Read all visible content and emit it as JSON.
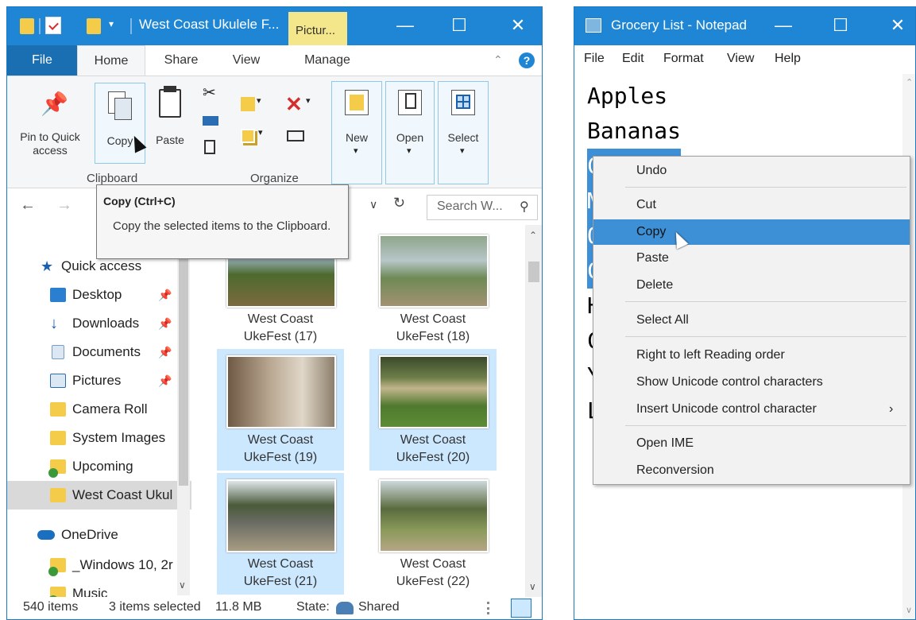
{
  "explorer": {
    "title": "West Coast Ukulele F...",
    "context_tab": "Pictur...",
    "tabs": [
      "File",
      "Home",
      "Share",
      "View",
      "Manage"
    ],
    "ribbon": {
      "pin": "Pin to Quick access",
      "copy": "Copy",
      "paste": "Paste",
      "new": "New",
      "open": "Open",
      "select": "Select",
      "group_clipboard": "Clipboard",
      "group_organize": "Organize"
    },
    "tooltip": {
      "title": "Copy (Ctrl+C)",
      "body": "Copy the selected items to the Clipboard."
    },
    "search_placeholder": "Search W...",
    "nav_items": [
      {
        "label": "Quick access",
        "icon": "star-icon"
      },
      {
        "label": "Desktop",
        "icon": "desktop-icon",
        "pinned": true
      },
      {
        "label": "Downloads",
        "icon": "download-icon",
        "pinned": true
      },
      {
        "label": "Documents",
        "icon": "document-icon",
        "pinned": true
      },
      {
        "label": "Pictures",
        "icon": "pictures-icon",
        "pinned": true
      },
      {
        "label": "Camera Roll",
        "icon": "folder-icon"
      },
      {
        "label": "System Images",
        "icon": "folder-icon"
      },
      {
        "label": "Upcoming",
        "icon": "folder-sync-icon"
      },
      {
        "label": "West Coast Ukul",
        "icon": "folder-icon",
        "selected": true
      },
      {
        "label": "OneDrive",
        "icon": "cloud-icon"
      },
      {
        "label": "_Windows 10, 2r",
        "icon": "folder-sync-icon"
      },
      {
        "label": "Music",
        "icon": "folder-sync-icon"
      }
    ],
    "tiles": [
      {
        "line1": "West Coast",
        "line2": "UkeFest (17)",
        "selected": false
      },
      {
        "line1": "West Coast",
        "line2": "UkeFest (18)",
        "selected": false
      },
      {
        "line1": "West Coast",
        "line2": "UkeFest (19)",
        "selected": true
      },
      {
        "line1": "West Coast",
        "line2": "UkeFest (20)",
        "selected": true
      },
      {
        "line1": "West Coast",
        "line2": "UkeFest (21)",
        "selected": true
      },
      {
        "line1": "West Coast",
        "line2": "UkeFest (22)",
        "selected": false
      }
    ],
    "status": {
      "items": "540 items",
      "selected": "3 items selected",
      "size": "11.8 MB",
      "state_label": "State:",
      "state_value": "Shared"
    }
  },
  "notepad": {
    "title": "Grocery List - Notepad",
    "menu": [
      "File",
      "Edit",
      "Format",
      "View",
      "Help"
    ],
    "lines": [
      "Apples",
      "Bananas",
      "Carrots",
      "M",
      "O",
      "C",
      "H",
      "C",
      "Y",
      "L"
    ],
    "context_menu": [
      {
        "label": "Undo"
      },
      {
        "label": "Cut"
      },
      {
        "label": "Copy",
        "highlight": true
      },
      {
        "label": "Paste"
      },
      {
        "label": "Delete"
      },
      {
        "label": "Select All"
      },
      {
        "label": "Right to left Reading order"
      },
      {
        "label": "Show Unicode control characters"
      },
      {
        "label": "Insert Unicode control character",
        "submenu": true
      },
      {
        "label": "Open IME"
      },
      {
        "label": "Reconversion"
      }
    ]
  },
  "colors": {
    "titlebar": "#1e86d4",
    "file_tab": "#1a6fb3",
    "picture_tools": "#f3e68b",
    "selection": "#cce8ff",
    "menu_highlight": "#3d8fd6"
  }
}
